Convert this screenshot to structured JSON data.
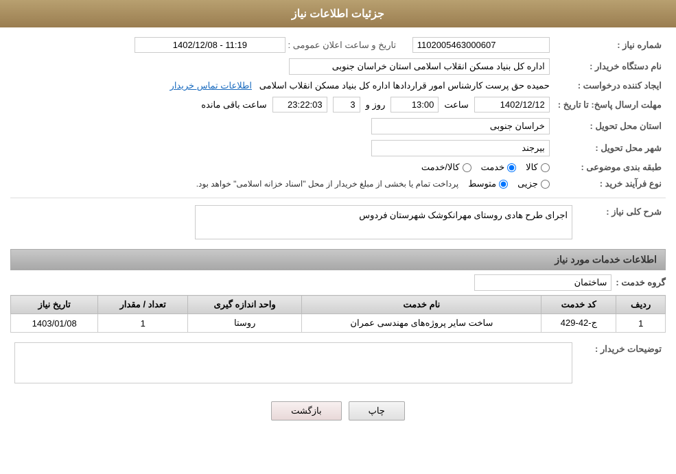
{
  "header": {
    "title": "جزئیات اطلاعات نیاز"
  },
  "fields": {
    "need_number_label": "شماره نیاز :",
    "need_number_value": "1102005463000607",
    "buyer_org_label": "نام دستگاه خریدار :",
    "buyer_org_value": "اداره کل بنیاد مسکن انقلاب اسلامی استان خراسان جنوبی",
    "creator_label": "ایجاد کننده درخواست :",
    "creator_value": "حمیده حق پرست کارشناس امور قراردادها اداره کل بنیاد مسکن انقلاب اسلامی",
    "contact_link": "اطلاعات تماس خریدار",
    "deadline_label": "مهلت ارسال پاسخ: تا تاریخ :",
    "deadline_date": "1402/12/12",
    "deadline_time_label": "ساعت",
    "deadline_time": "13:00",
    "deadline_day_label": "روز و",
    "deadline_days": "3",
    "deadline_remaining_label": "ساعت باقی مانده",
    "deadline_remaining": "23:22:03",
    "announce_date_label": "تاریخ و ساعت اعلان عمومی :",
    "announce_value": "1402/12/08 - 11:19",
    "province_label": "استان محل تحویل :",
    "province_value": "خراسان جنوبی",
    "city_label": "شهر محل تحویل :",
    "city_value": "بیرجند",
    "category_label": "طبقه بندی موضوعی :",
    "category_options": [
      "کالا",
      "خدمت",
      "کالا/خدمت"
    ],
    "category_selected": "خدمت",
    "purchase_type_label": "نوع فرآیند خرید :",
    "purchase_type_options": [
      "جزیی",
      "متوسط"
    ],
    "purchase_type_note": "پرداخت تمام یا بخشی از مبلغ خریدار از محل \"اسناد خزانه اسلامی\" خواهد بود.",
    "need_desc_label": "شرح کلی نیاز :",
    "need_desc_value": "اجرای طرح هادی روستای مهرانکوشک شهرستان فردوس",
    "services_section": "اطلاعات خدمات مورد نیاز",
    "service_group_label": "گروه خدمت :",
    "service_group_value": "ساختمان",
    "services_table": {
      "columns": [
        "ردیف",
        "کد خدمت",
        "نام خدمت",
        "واحد اندازه گیری",
        "تعداد / مقدار",
        "تاریخ نیاز"
      ],
      "rows": [
        {
          "row": "1",
          "code": "ج-42-429",
          "name": "ساخت سایر پروژه‌های مهندسی عمران",
          "unit": "روستا",
          "qty": "1",
          "date": "1403/01/08"
        }
      ]
    },
    "buyer_notes_label": "توضیحات خریدار :",
    "buyer_notes_value": ""
  },
  "buttons": {
    "print": "چاپ",
    "back": "بازگشت"
  }
}
